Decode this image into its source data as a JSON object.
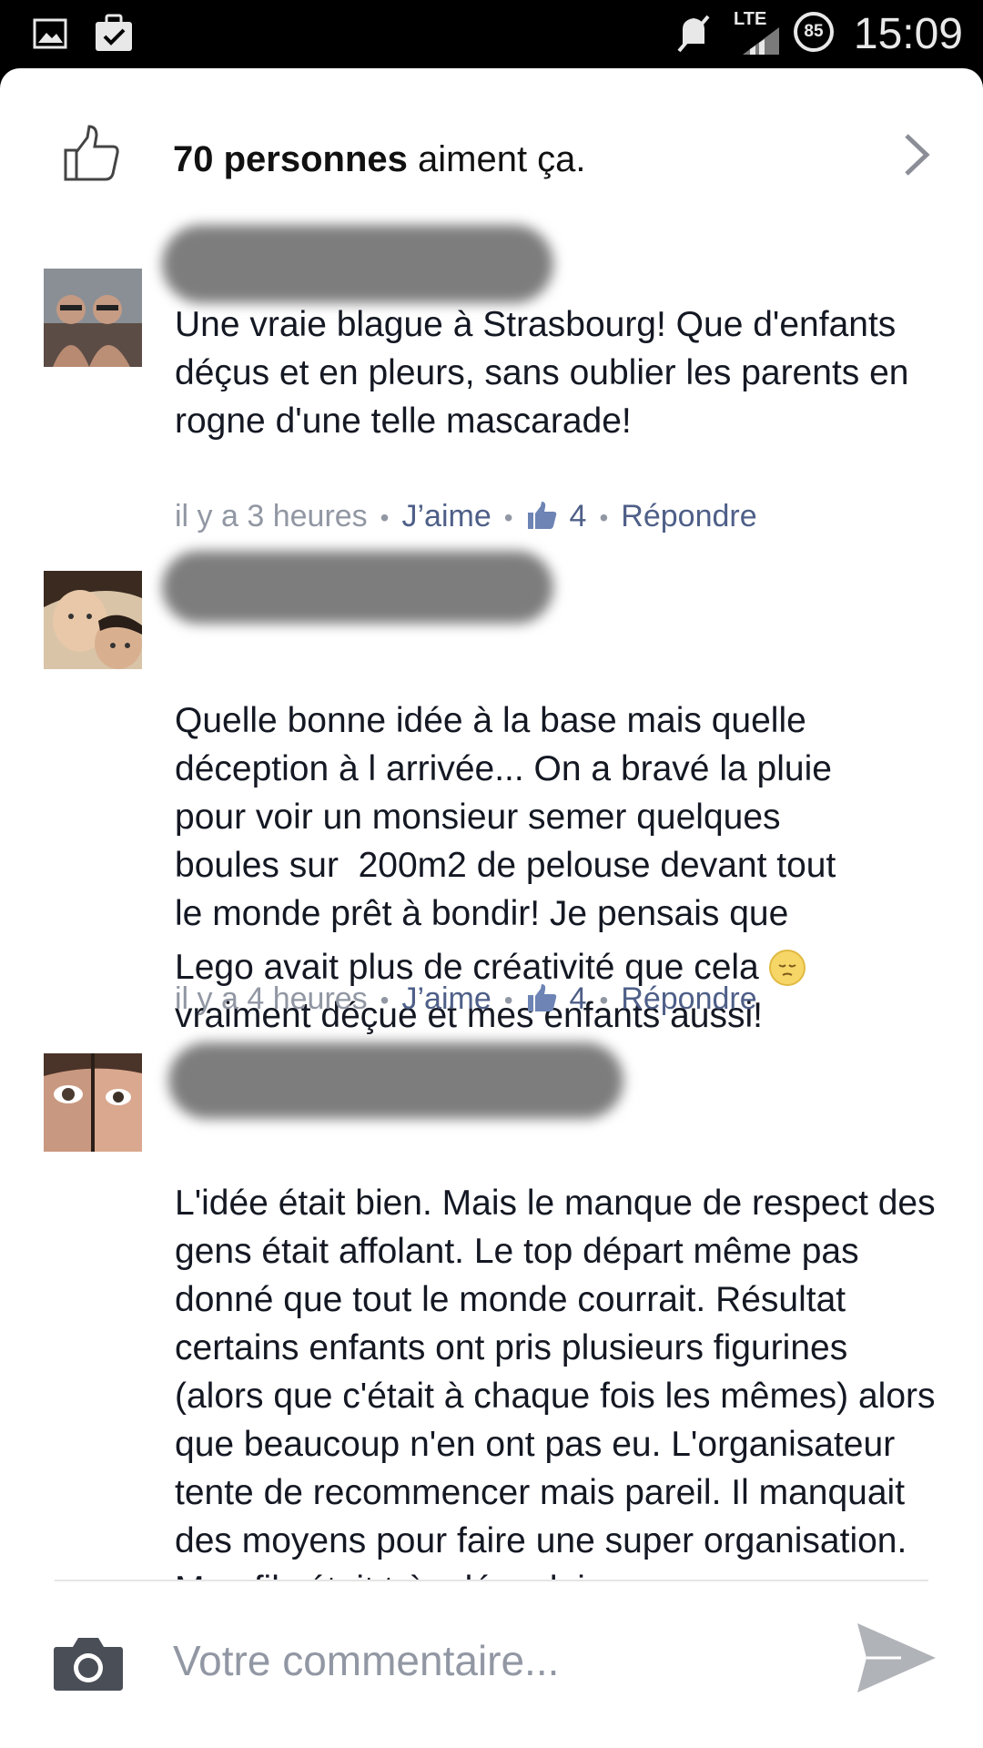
{
  "status_bar": {
    "time": "15:09",
    "network": "LTE",
    "battery": "85",
    "icons": [
      "gallery-icon",
      "clipboard-check-icon",
      "muted-icon",
      "signal-icon",
      "battery-icon"
    ]
  },
  "likes": {
    "count_text": "70 personnes",
    "suffix": " aiment ça."
  },
  "comments": [
    {
      "text": "Une vraie blague à Strasbourg! Que d'enfants déçus et en pleurs, sans oublier les parents en rogne d'une telle mascarade!",
      "time": "il y a 3 heures",
      "like_label": "J’aime",
      "like_count": "4",
      "reply_label": "Répondre"
    },
    {
      "text_lines": [
        "Quelle bonne idée à la base mais quelle",
        "déception à l arrivée... On a bravé la pluie",
        "pour voir un monsieur semer quelques",
        "boules sur  200m2 de pelouse devant tout",
        "le monde prêt à bondir! Je pensais que"
      ],
      "text_line_emoji": "Lego avait plus de créativité que cela",
      "text_last": "vraiment déçue et mes enfants aussi!",
      "time": "il y a 4 heures",
      "like_label": "J’aime",
      "like_count": "4",
      "reply_label": "Répondre"
    },
    {
      "text": "L'idée était bien. Mais le manque de respect des gens était affolant. Le top départ même pas donné que tout le monde courrait. Résultat certains enfants ont pris plusieurs figurines (alors que c'était à chaque fois les mêmes) alors que beaucoup n'en ont pas eu. L'organisateur tente de recommencer mais pareil. Il manquait des moyens pour faire une super organisation. Mon fils était très déçu, lui"
    }
  ],
  "composer": {
    "placeholder": "Votre commentaire..."
  },
  "colors": {
    "link": "#4e5f88",
    "meta": "#9197a3",
    "text": "#141823"
  }
}
